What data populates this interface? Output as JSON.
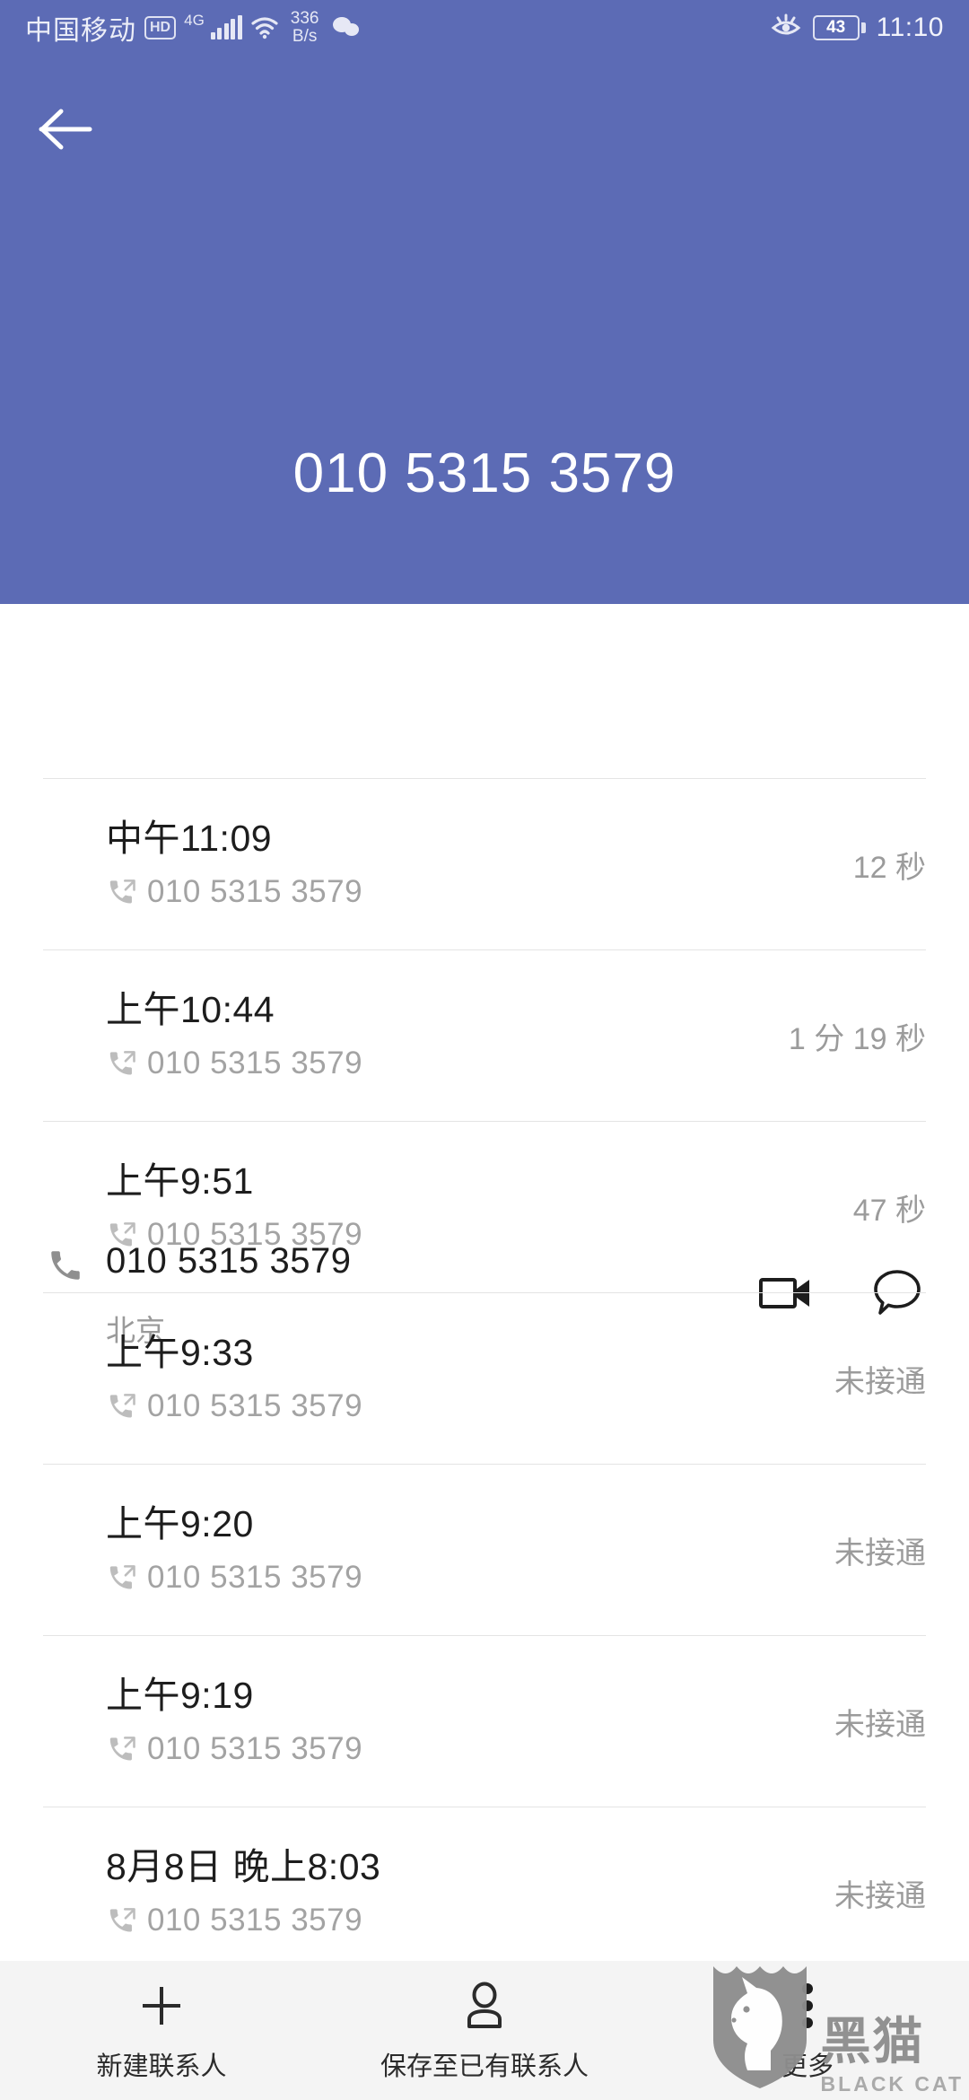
{
  "statusbar": {
    "carrier": "中国移动",
    "hd_badge": "HD",
    "network": "4G",
    "data_speed_value": "336",
    "data_speed_unit": "B/s",
    "battery_percent": "43",
    "clock": "11:10",
    "icons": [
      "wifi-icon",
      "signal-bars-icon",
      "wechat-icon",
      "eye-comfort-icon",
      "battery-icon"
    ]
  },
  "header": {
    "back_icon": "back-arrow-icon",
    "phone_number": "010 5315 3579",
    "background_color": "#5c6bb5"
  },
  "contact": {
    "phone_icon": "phone-icon",
    "number": "010 5315 3579",
    "region": "北京",
    "video_call_icon": "video-camera-icon",
    "message_icon": "message-bubble-icon"
  },
  "call_log": [
    {
      "time": "中午11:09",
      "number": "010 5315 3579",
      "duration": "12 秒",
      "direction_icon": "outgoing-call-icon"
    },
    {
      "time": "上午10:44",
      "number": "010 5315 3579",
      "duration": "1 分 19 秒",
      "direction_icon": "outgoing-call-icon"
    },
    {
      "time": "上午9:51",
      "number": "010 5315 3579",
      "duration": "47 秒",
      "direction_icon": "outgoing-call-icon"
    },
    {
      "time": "上午9:33",
      "number": "010 5315 3579",
      "duration": "未接通",
      "direction_icon": "outgoing-call-icon"
    },
    {
      "time": "上午9:20",
      "number": "010 5315 3579",
      "duration": "未接通",
      "direction_icon": "outgoing-call-icon"
    },
    {
      "time": "上午9:19",
      "number": "010 5315 3579",
      "duration": "未接通",
      "direction_icon": "outgoing-call-icon"
    },
    {
      "time": "8月8日 晚上8:03",
      "number": "010 5315 3579",
      "duration": "未接通",
      "direction_icon": "outgoing-call-icon"
    }
  ],
  "bottom_bar": {
    "items": [
      {
        "label": "新建联系人",
        "icon": "plus-icon"
      },
      {
        "label": "保存至已有联系人",
        "icon": "person-icon"
      },
      {
        "label": "更多",
        "icon": "more-vertical-icon"
      }
    ]
  },
  "watermark": {
    "cn": "黑猫",
    "en": "BLACK CAT",
    "icon": "black-cat-shield-logo"
  }
}
